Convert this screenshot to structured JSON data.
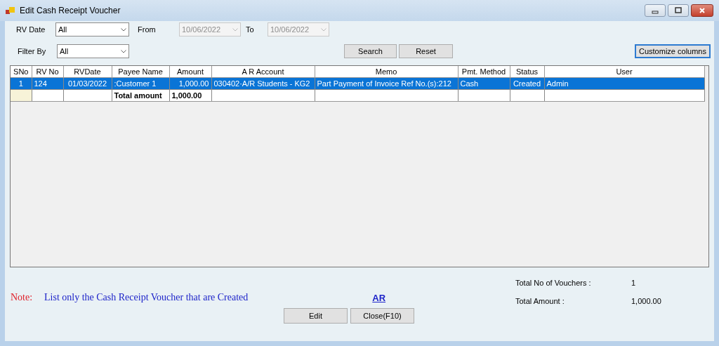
{
  "window": {
    "title": "Edit Cash Receipt Voucher"
  },
  "filters": {
    "rv_date": {
      "label": "RV Date",
      "value": "All"
    },
    "from": {
      "label": "From",
      "value": "10/06/2022",
      "disabled": true
    },
    "to": {
      "label": "To",
      "value": "10/06/2022",
      "disabled": true
    },
    "filter_by": {
      "label": "Filter By",
      "value": "All"
    }
  },
  "buttons": {
    "search": "Search",
    "reset": "Reset",
    "customize": "Customize columns",
    "edit": "Edit",
    "close": "Close(F10)"
  },
  "table": {
    "columns": [
      "SNo",
      "RV  No",
      "RVDate",
      "Payee Name",
      "Amount",
      "A R Account",
      "Memo",
      "Pmt. Method",
      "Status",
      "User"
    ],
    "rows": [
      {
        "kind": "data",
        "selected": true,
        "cells": [
          "1",
          "124",
          "01/03/2022",
          ":Customer 1",
          "1,000.00",
          "030402·A/R Students - KG2",
          "Part Payment of Invoice Ref No.(s):212",
          "Cash",
          "Created",
          "Admin"
        ]
      },
      {
        "kind": "total",
        "selected": false,
        "cells": [
          "",
          "",
          "",
          "Total amount",
          "1,000.00",
          "",
          "",
          "",
          "",
          ""
        ]
      }
    ]
  },
  "note": {
    "label": "Note:",
    "text": "List only the Cash Receipt Voucher that are Created"
  },
  "link": "AR",
  "summary": [
    {
      "label": "Total No of Vouchers :",
      "value": "1"
    },
    {
      "label": "Total Amount :",
      "value": "1,000.00"
    }
  ]
}
